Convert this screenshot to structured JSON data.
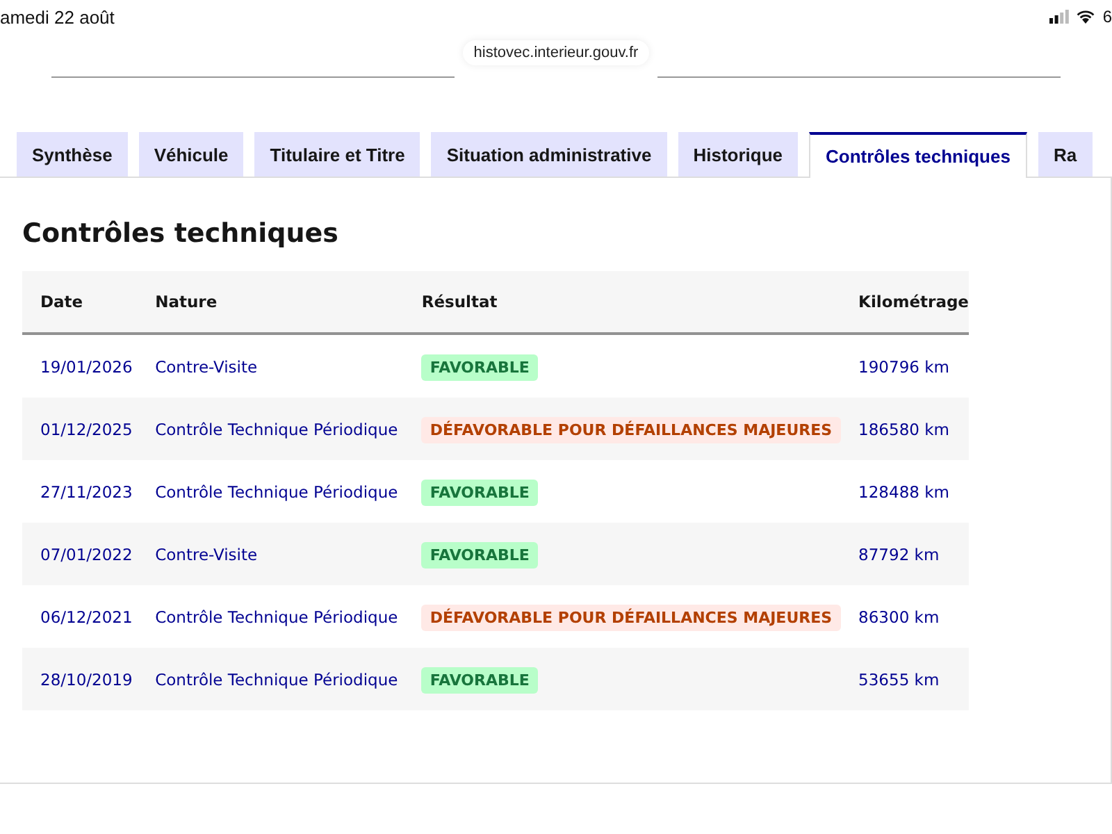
{
  "status_bar": {
    "date": "amedi 22 août",
    "battery": "6"
  },
  "browser": {
    "url": "histovec.interieur.gouv.fr"
  },
  "tabs": [
    {
      "label": "Synthèse",
      "selected": false
    },
    {
      "label": "Véhicule",
      "selected": false
    },
    {
      "label": "Titulaire et Titre",
      "selected": false
    },
    {
      "label": "Situation administrative",
      "selected": false
    },
    {
      "label": "Historique",
      "selected": false
    },
    {
      "label": "Contrôles techniques",
      "selected": true
    },
    {
      "label": "Ra",
      "selected": false
    }
  ],
  "section": {
    "title": "Contrôles techniques"
  },
  "table": {
    "columns": [
      "Date",
      "Nature",
      "Résultat",
      "Kilométrage"
    ],
    "rows": [
      {
        "date": "19/01/2026",
        "nature": "Contre-Visite",
        "result": {
          "text": "FAVORABLE",
          "kind": "favorable"
        },
        "mileage": "190796 km"
      },
      {
        "date": "01/12/2025",
        "nature": "Contrôle Technique Périodique",
        "result": {
          "text": "DÉFAVORABLE POUR DÉFAILLANCES MAJEURES",
          "kind": "defavorable"
        },
        "mileage": "186580 km"
      },
      {
        "date": "27/11/2023",
        "nature": "Contrôle Technique Périodique",
        "result": {
          "text": "FAVORABLE",
          "kind": "favorable"
        },
        "mileage": "128488 km"
      },
      {
        "date": "07/01/2022",
        "nature": "Contre-Visite",
        "result": {
          "text": "FAVORABLE",
          "kind": "favorable"
        },
        "mileage": "87792 km"
      },
      {
        "date": "06/12/2021",
        "nature": "Contrôle Technique Périodique",
        "result": {
          "text": "DÉFAVORABLE POUR DÉFAILLANCES MAJEURES",
          "kind": "defavorable"
        },
        "mileage": "86300 km"
      },
      {
        "date": "28/10/2019",
        "nature": "Contrôle Technique Périodique",
        "result": {
          "text": "FAVORABLE",
          "kind": "favorable"
        },
        "mileage": "53655 km"
      }
    ]
  }
}
